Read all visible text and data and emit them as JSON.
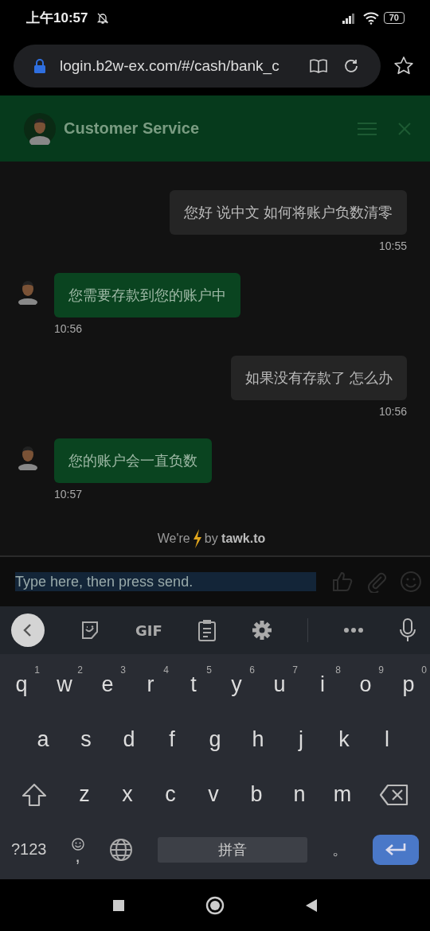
{
  "status_bar": {
    "time": "上午10:57",
    "battery": "70"
  },
  "browser": {
    "url": "login.b2w-ex.com/#/cash/bank_c"
  },
  "header": {
    "title": "Customer Service"
  },
  "messages": [
    {
      "kind": "visitor",
      "text": "您好 说中文 如何将账户负数清零",
      "time": "10:55"
    },
    {
      "kind": "agent",
      "text": "您需要存款到您的账户中",
      "time": "10:56"
    },
    {
      "kind": "visitor",
      "text": "如果没有存款了 怎么办",
      "time": "10:56"
    },
    {
      "kind": "agent",
      "text": "您的账户会一直负数",
      "time": "10:57"
    }
  ],
  "branding": {
    "prefix": "We're",
    "suffix": "by",
    "brand": "tawk.to"
  },
  "input": {
    "placeholder": "Type here, then press send."
  },
  "keyboard": {
    "gif": "GIF",
    "rows": [
      [
        {
          "label": "q",
          "hint": "1"
        },
        {
          "label": "w",
          "hint": "2"
        },
        {
          "label": "e",
          "hint": "3"
        },
        {
          "label": "r",
          "hint": "4"
        },
        {
          "label": "t",
          "hint": "5"
        },
        {
          "label": "y",
          "hint": "6"
        },
        {
          "label": "u",
          "hint": "7"
        },
        {
          "label": "i",
          "hint": "8"
        },
        {
          "label": "o",
          "hint": "9"
        },
        {
          "label": "p",
          "hint": "0"
        }
      ],
      [
        {
          "label": "a"
        },
        {
          "label": "s"
        },
        {
          "label": "d"
        },
        {
          "label": "f"
        },
        {
          "label": "g"
        },
        {
          "label": "h"
        },
        {
          "label": "j"
        },
        {
          "label": "k"
        },
        {
          "label": "l"
        }
      ],
      [
        {
          "label": "z"
        },
        {
          "label": "x"
        },
        {
          "label": "c"
        },
        {
          "label": "v"
        },
        {
          "label": "b"
        },
        {
          "label": "n"
        },
        {
          "label": "m"
        }
      ]
    ],
    "symbols": "?123",
    "comma": ",",
    "space": "拼音",
    "period": "。"
  }
}
